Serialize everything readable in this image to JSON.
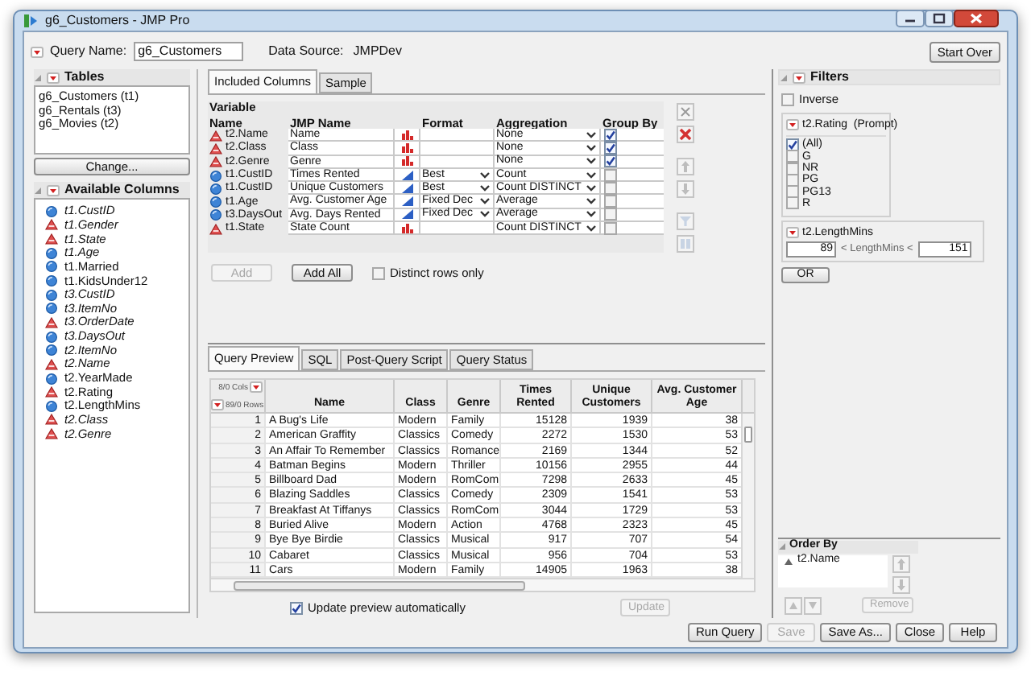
{
  "window": {
    "title": "g6_Customers - JMP Pro"
  },
  "query_name": {
    "label": "Query Name:",
    "value": "g6_Customers"
  },
  "data_source": {
    "label": "Data Source:",
    "value": "JMPDev"
  },
  "start_over": "Start Over",
  "tables": {
    "title": "Tables",
    "items": [
      "g6_Customers (t1)",
      "g6_Rentals (t3)",
      "g6_Movies (t2)"
    ],
    "button": "Change..."
  },
  "available_columns": {
    "title": "Available Columns",
    "items": [
      {
        "name": "t1.CustID",
        "kind": "numeric",
        "used": true
      },
      {
        "name": "t1.Gender",
        "kind": "character",
        "used": true
      },
      {
        "name": "t1.State",
        "kind": "character",
        "used": true
      },
      {
        "name": "t1.Age",
        "kind": "numeric",
        "used": true
      },
      {
        "name": "t1.Married",
        "kind": "numeric",
        "used": false
      },
      {
        "name": "t1.KidsUnder12",
        "kind": "numeric",
        "used": false
      },
      {
        "name": "t3.CustID",
        "kind": "numeric",
        "used": true
      },
      {
        "name": "t3.ItemNo",
        "kind": "numeric",
        "used": true
      },
      {
        "name": "t3.OrderDate",
        "kind": "character",
        "used": true
      },
      {
        "name": "t3.DaysOut",
        "kind": "numeric",
        "used": true
      },
      {
        "name": "t2.ItemNo",
        "kind": "numeric",
        "used": true
      },
      {
        "name": "t2.Name",
        "kind": "character",
        "used": true
      },
      {
        "name": "t2.YearMade",
        "kind": "numeric",
        "used": false
      },
      {
        "name": "t2.Rating",
        "kind": "character",
        "used": false
      },
      {
        "name": "t2.LengthMins",
        "kind": "numeric",
        "used": false
      },
      {
        "name": "t2.Class",
        "kind": "character",
        "used": true
      },
      {
        "name": "t2.Genre",
        "kind": "character",
        "used": true
      }
    ]
  },
  "top_tabs": [
    {
      "label": "Included Columns",
      "selected": true
    },
    {
      "label": "Sample",
      "selected": false
    }
  ],
  "included_columns": {
    "header_top": "Variable",
    "columns": [
      "Name",
      "JMP Name",
      "Format",
      "Aggregation",
      "Group By"
    ],
    "rows": [
      {
        "kind": "character",
        "name": "t2.Name",
        "jmp_name": "Name",
        "format": "",
        "aggregation": "None",
        "group_by": true
      },
      {
        "kind": "character",
        "name": "t2.Class",
        "jmp_name": "Class",
        "format": "",
        "aggregation": "None",
        "group_by": true
      },
      {
        "kind": "character",
        "name": "t2.Genre",
        "jmp_name": "Genre",
        "format": "",
        "aggregation": "None",
        "group_by": true
      },
      {
        "kind": "numeric",
        "name": "t1.CustID",
        "jmp_name": "Times Rented",
        "format": "Best",
        "aggregation": "Count",
        "group_by": false
      },
      {
        "kind": "numeric",
        "name": "t1.CustID",
        "jmp_name": "Unique Customers",
        "format": "Best",
        "aggregation": "Count DISTINCT",
        "group_by": false
      },
      {
        "kind": "numeric",
        "name": "t1.Age",
        "jmp_name": "Avg. Customer Age",
        "format": "Fixed Dec",
        "aggregation": "Average",
        "group_by": false
      },
      {
        "kind": "numeric",
        "name": "t3.DaysOut",
        "jmp_name": "Avg. Days Rented",
        "format": "Fixed Dec",
        "aggregation": "Average",
        "group_by": false
      },
      {
        "kind": "character",
        "name": "t1.State",
        "jmp_name": "State Count",
        "format": "",
        "aggregation": "Count DISTINCT",
        "group_by": false
      }
    ]
  },
  "add_button": {
    "label": "Add",
    "disabled": true
  },
  "add_all_button": {
    "label": "Add All",
    "disabled": false
  },
  "distinct_rows": {
    "label": "Distinct rows only",
    "checked": false
  },
  "bottom_tabs": [
    {
      "label": "Query Preview",
      "selected": true
    },
    {
      "label": "SQL",
      "selected": false
    },
    {
      "label": "Post-Query Script",
      "selected": false
    },
    {
      "label": "Query Status",
      "selected": false
    }
  ],
  "preview": {
    "cols_count": "8/0 Cols",
    "rows_count": "89/0 Rows",
    "columns": [
      "Name",
      "Class",
      "Genre",
      "Times Rented",
      "Unique Customers",
      "Avg. Customer Age"
    ],
    "rows": [
      {
        "row": "1",
        "cells": [
          "A Bug's Life",
          "Modern",
          "Family",
          "15128",
          "1939",
          "38"
        ]
      },
      {
        "row": "2",
        "cells": [
          "American Graffity",
          "Classics",
          "Comedy",
          "2272",
          "1530",
          "53"
        ]
      },
      {
        "row": "3",
        "cells": [
          "An Affair To Remember",
          "Classics",
          "Romance",
          "2169",
          "1344",
          "52"
        ]
      },
      {
        "row": "4",
        "cells": [
          "Batman Begins",
          "Modern",
          "Thriller",
          "10156",
          "2955",
          "44"
        ]
      },
      {
        "row": "5",
        "cells": [
          "Billboard Dad",
          "Modern",
          "RomCom",
          "7298",
          "2633",
          "45"
        ]
      },
      {
        "row": "6",
        "cells": [
          "Blazing Saddles",
          "Classics",
          "Comedy",
          "2309",
          "1541",
          "53"
        ]
      },
      {
        "row": "7",
        "cells": [
          "Breakfast At Tiffanys",
          "Classics",
          "RomCom",
          "3044",
          "1729",
          "53"
        ]
      },
      {
        "row": "8",
        "cells": [
          "Buried Alive",
          "Modern",
          "Action",
          "4768",
          "2323",
          "45"
        ]
      },
      {
        "row": "9",
        "cells": [
          "Bye Bye Birdie",
          "Classics",
          "Musical",
          "917",
          "707",
          "54"
        ]
      },
      {
        "row": "10",
        "cells": [
          "Cabaret",
          "Classics",
          "Musical",
          "956",
          "704",
          "53"
        ]
      },
      {
        "row": "11",
        "cells": [
          "Cars",
          "Modern",
          "Family",
          "14905",
          "1963",
          "38"
        ]
      }
    ]
  },
  "update_automatically": {
    "label": "Update preview automatically",
    "checked": true
  },
  "update_button": {
    "label": "Update",
    "disabled": true
  },
  "filters": {
    "title": "Filters",
    "inverse": {
      "label": "Inverse",
      "checked": false
    },
    "rating": {
      "title": "t2.Rating  (Prompt)",
      "items": [
        {
          "label": "(All)",
          "checked": true
        },
        {
          "label": "G",
          "checked": false
        },
        {
          "label": "NR",
          "checked": false
        },
        {
          "label": "PG",
          "checked": false
        },
        {
          "label": "PG13",
          "checked": false
        },
        {
          "label": "R",
          "checked": false
        }
      ]
    },
    "length": {
      "title": "t2.LengthMins",
      "min": "89",
      "label": "< LengthMins <",
      "max": "151"
    },
    "or_button": "OR"
  },
  "order_by": {
    "title": "Order By",
    "items": [
      "t2.Name"
    ],
    "remove": {
      "label": "Remove",
      "disabled": true
    }
  },
  "bottom_buttons": [
    {
      "label": "Run Query",
      "disabled": false
    },
    {
      "label": "Save",
      "disabled": true
    },
    {
      "label": "Save As...",
      "disabled": false
    },
    {
      "label": "Close",
      "disabled": false
    },
    {
      "label": "Help",
      "disabled": false
    }
  ]
}
